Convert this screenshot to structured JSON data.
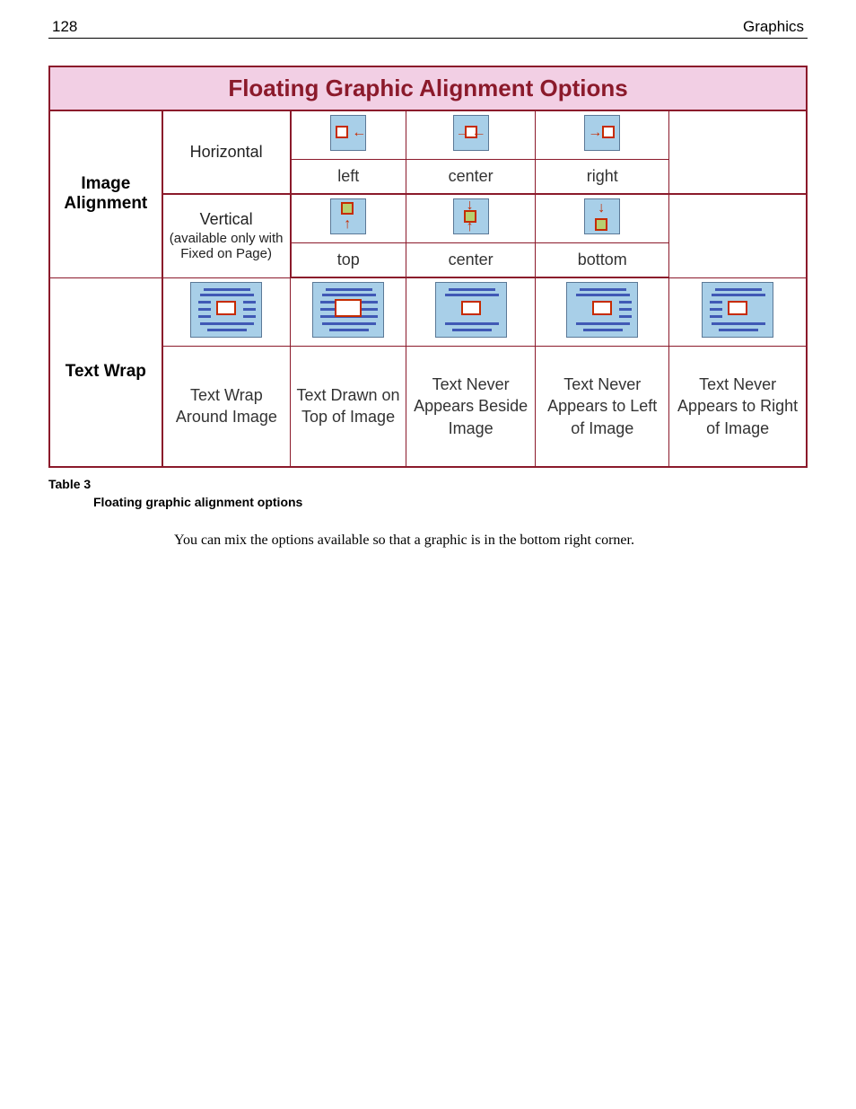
{
  "page": {
    "number": "128",
    "section": "Graphics"
  },
  "table": {
    "title": "Floating Graphic Alignment Options",
    "row1_label": "Image Alignment",
    "horizontal": {
      "label": "Horizontal",
      "opts": [
        "left",
        "center",
        "right"
      ]
    },
    "vertical": {
      "label": "Vertical",
      "note": "(available only with Fixed on Page)",
      "opts": [
        "top",
        "center",
        "bottom"
      ]
    },
    "row2_label": "Text Wrap",
    "wrap_opts": [
      "Text Wrap Around Image",
      "Text Drawn on Top of Image",
      "Text Never Appears Beside Image",
      "Text Never Appears to Left of Image",
      "Text Never Appears to Right of Image"
    ]
  },
  "caption": {
    "label": "Table 3",
    "desc": "Floating graphic alignment options"
  },
  "body": "You can mix the options available so that a graphic is in the bottom right corner."
}
